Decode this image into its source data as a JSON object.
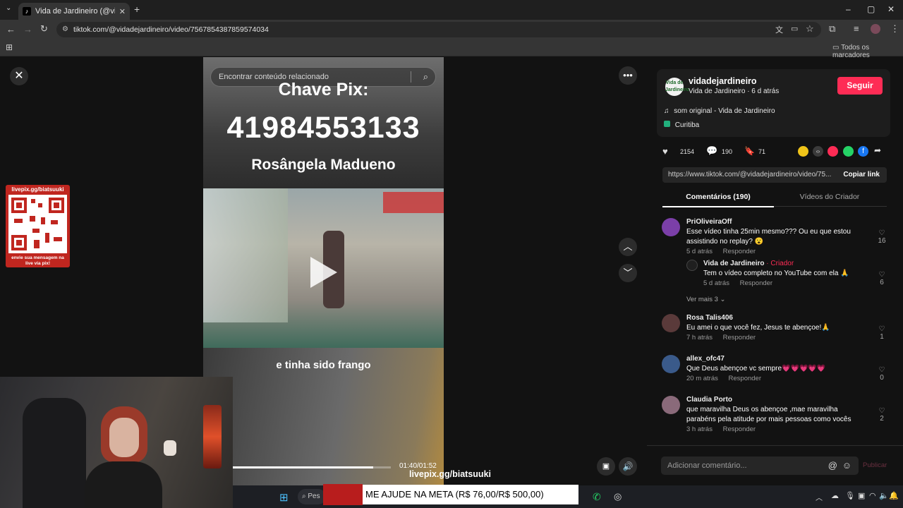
{
  "browser": {
    "tab_title": "Vida de Jardineiro (@vidadejar",
    "tab_close": "✕",
    "new_tab": "+",
    "url": "tiktok.com/@vidadejardineiro/video/7567854387859574034",
    "bookmarks_label": "Todos os marcadores"
  },
  "video": {
    "search_placeholder": "Encontrar conteúdo relacionado",
    "overlay_title": "Chave Pix:",
    "overlay_number": "41984553133",
    "overlay_name": "Rosângela Madueno",
    "caption": "e tinha sido frango",
    "timecode": "01:40/01:52",
    "progress_fraction": 0.89
  },
  "creator": {
    "username": "vidadejardineiro",
    "avatar_text": "Vida de Jardineiro",
    "subtitle": "Vida de Jardineiro · 6 d atrás",
    "music": "som original - Vida de Jardineiro",
    "location": "Curitiba",
    "follow_label": "Seguir"
  },
  "stats": {
    "likes": "2154",
    "comments": "190",
    "saves": "71"
  },
  "link": {
    "url": "https://www.tiktok.com/@vidadejardineiro/video/75...",
    "copy_label": "Copiar link"
  },
  "tabs": {
    "comments": "Comentários (190)",
    "creator_videos": "Vídeos do Criador"
  },
  "comments": [
    {
      "user": "PriOliveiraOff",
      "text": "Esse vídeo tinha 25min mesmo??? Ou eu que estou assistindo no replay? 😮",
      "time": "5 d atrás",
      "reply": "Responder",
      "likes": "16"
    },
    {
      "user": "Vida de Jardineiro",
      "badge": "· Criador",
      "text": "Tem o vídeo completo no YouTube com ela 🙏",
      "time": "5 d atrás",
      "reply": "Responder",
      "likes": "6"
    },
    {
      "user": "Rosa Talis406",
      "text": "Eu amei o que você fez, Jesus te abençoe!🙏",
      "time": "7 h atrás",
      "reply": "Responder",
      "likes": "1"
    },
    {
      "user": "allex_ofc47",
      "text": "Que Deus abençoe vc sempre💗💗💗💗💗",
      "time": "20 m atrás",
      "reply": "Responder",
      "likes": "0"
    },
    {
      "user": "Claudia Porto",
      "text": "que maravilha Deus os abençoe ,mae maravilha parabéns pela atitude por mais pessoas como vocês",
      "time": "3 h atrás",
      "reply": "Responder",
      "likes": "2"
    }
  ],
  "see_more": "Ver mais 3",
  "add_comment_placeholder": "Adicionar comentário...",
  "publish_label": "Publicar",
  "stream": {
    "qr_title": "livepix.gg/biatsuuki",
    "qr_caption": "envie sua mensagem na live via pix!",
    "livepix_label": "livepix.gg/biatsuuki",
    "meta_banner": "ME AJUDE NA META (R$ 76,00/R$ 500,00)"
  },
  "taskbar": {
    "search_text": "Pes"
  }
}
